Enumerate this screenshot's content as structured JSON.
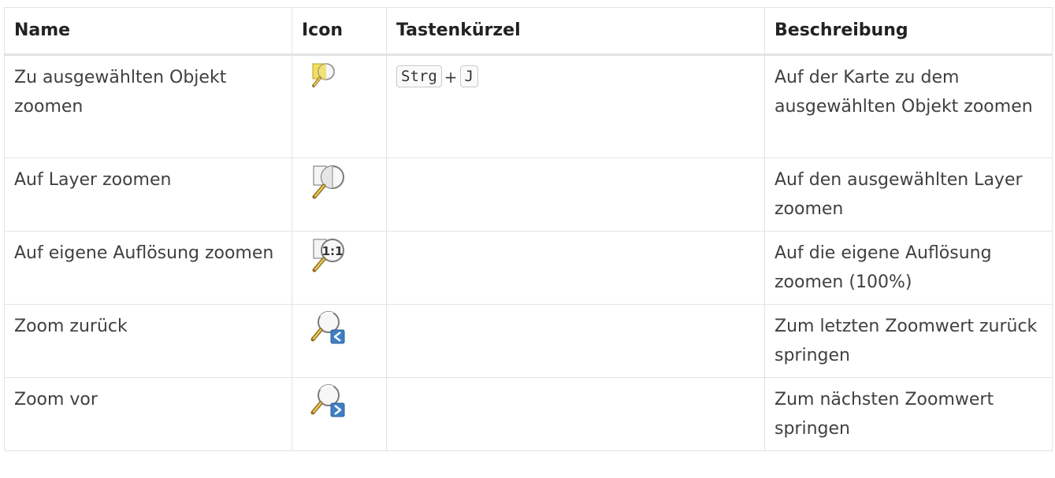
{
  "table": {
    "headers": {
      "name": "Name",
      "icon": "Icon",
      "shortcut": "Tastenkürzel",
      "description": "Beschreibung"
    },
    "rows": [
      {
        "name": "Zu ausgewählten Objekt zoomen",
        "icon": "zoom-to-selection-icon",
        "shortcut_keys": [
          "Strg",
          "J"
        ],
        "shortcut_separator": "+",
        "description": "Auf der Karte zu dem ausgewählten Objekt zoomen"
      },
      {
        "name": "Auf Layer zoomen",
        "icon": "zoom-to-layer-icon",
        "description": "Auf den ausgewählten Layer zoomen"
      },
      {
        "name": "Auf eigene Auflösung zoomen",
        "icon": "zoom-actual-size-icon",
        "icon_text": "1:1",
        "description": "Auf die eigene Auflösung zoomen (100%)"
      },
      {
        "name": "Zoom zurück",
        "icon": "zoom-last-icon",
        "description": "Zum letzten Zoomwert zurück springen"
      },
      {
        "name": "Zoom vor",
        "icon": "zoom-next-icon",
        "description": "Zum nächsten Zoomwert springen"
      }
    ]
  }
}
